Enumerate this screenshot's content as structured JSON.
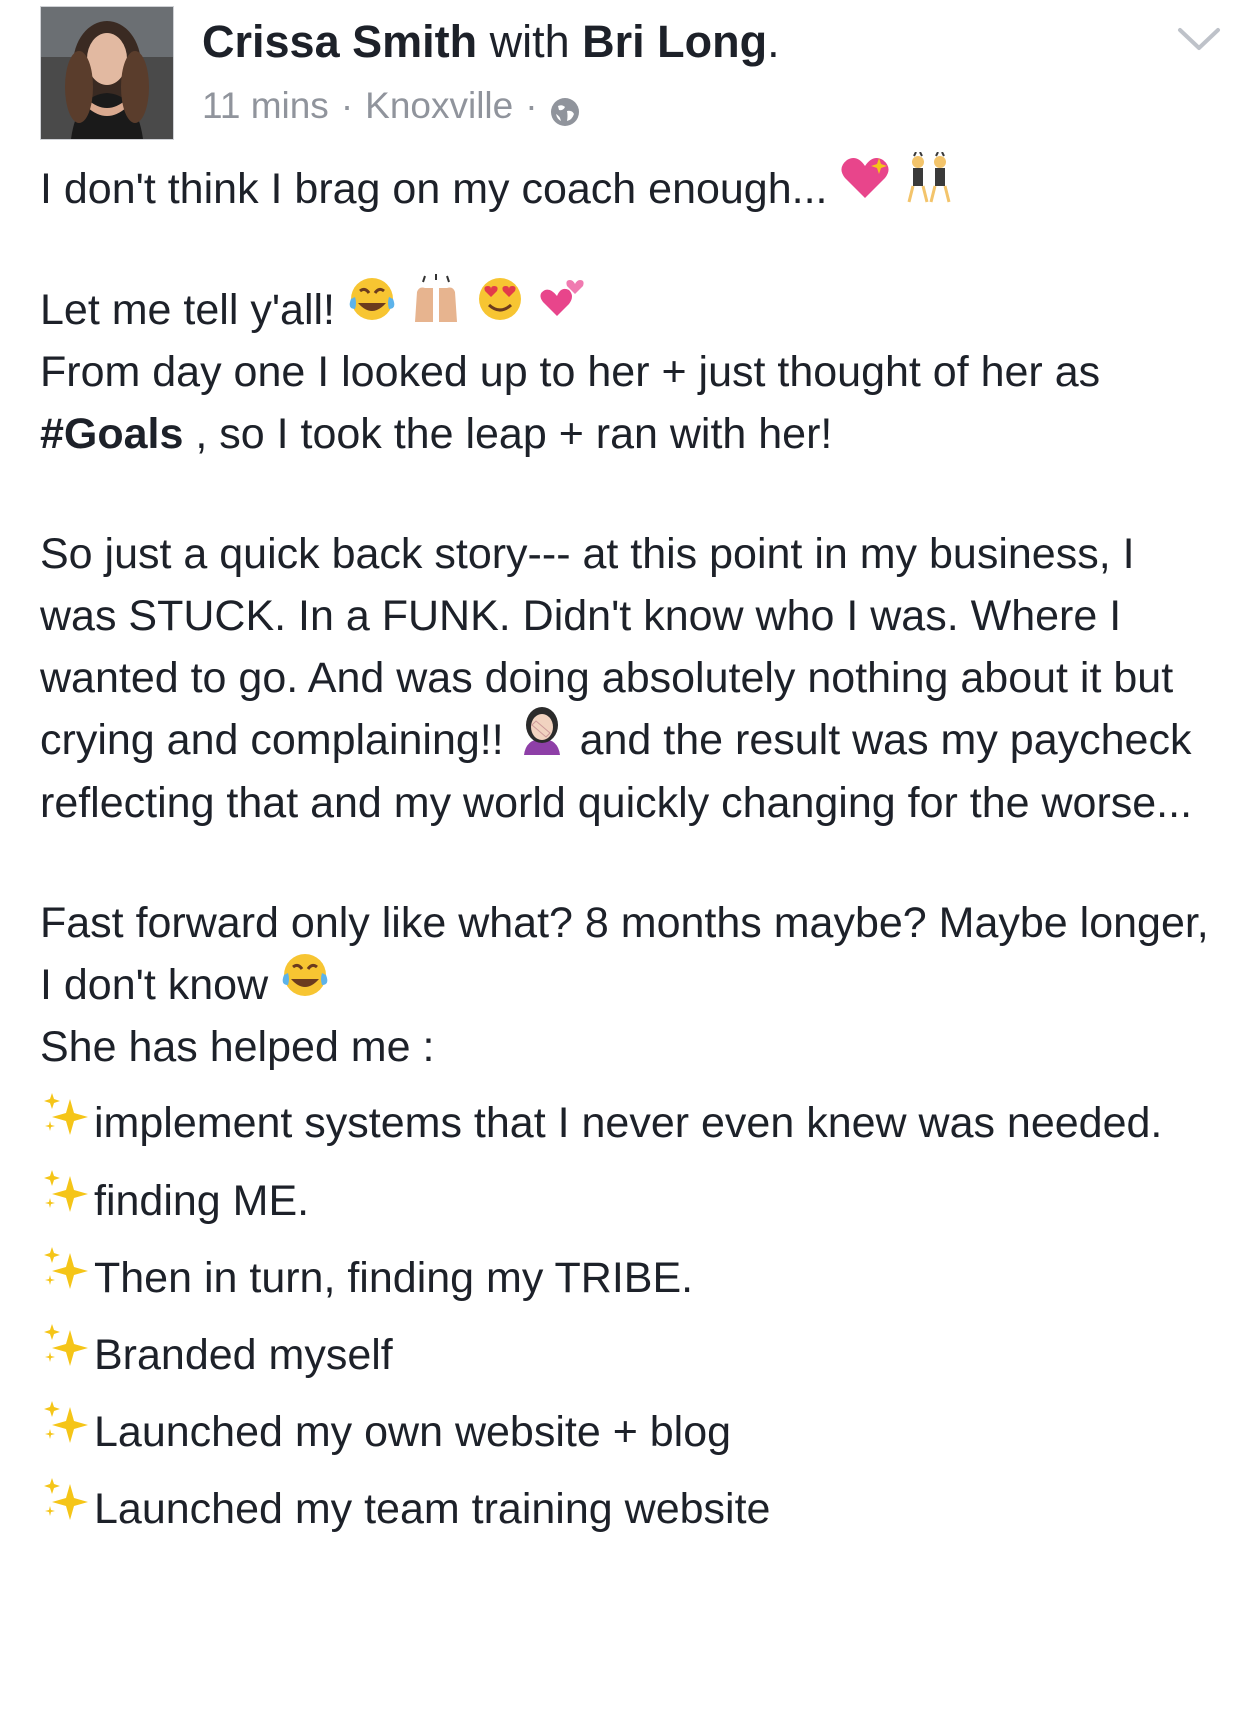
{
  "post": {
    "author": "Crissa Smith",
    "with_text": "with",
    "tagged": "Bri Long",
    "period": ".",
    "time": "11 mins",
    "separator": "·",
    "location": "Knoxville",
    "privacy_icon": "globe-icon",
    "menu_icon": "chevron-down-icon"
  },
  "body": {
    "line1": "I don't think I brag on my coach enough...",
    "line2": "Let me tell y'all!",
    "line3a": "From day one I looked up to her + just thought of her as ",
    "hashtag": "#Goals",
    "line3b": " , so I took the leap + ran with her!",
    "para3a": "So just a quick back story--- at this point in my business, I was STUCK. In a FUNK. Didn't know who I was. Where I wanted to go. And was doing absolutely nothing about it but crying and complaining!!",
    "para3b": " and the result was my paycheck reflecting that and my world quickly changing for the worse...",
    "para4a": "Fast forward only like what? 8 months maybe? Maybe longer, I don't know",
    "para4b": "She has helped me :",
    "bullets": [
      "implement systems that I never even knew was needed.",
      "finding ME.",
      "Then in turn, finding my TRIBE.",
      "Branded myself",
      "Launched my own website + blog",
      "Launched my team training website"
    ]
  },
  "colors": {
    "text": "#1d2129",
    "meta": "#90949c",
    "accent_pink": "#e8458b",
    "sparkle": "#f5c518"
  }
}
